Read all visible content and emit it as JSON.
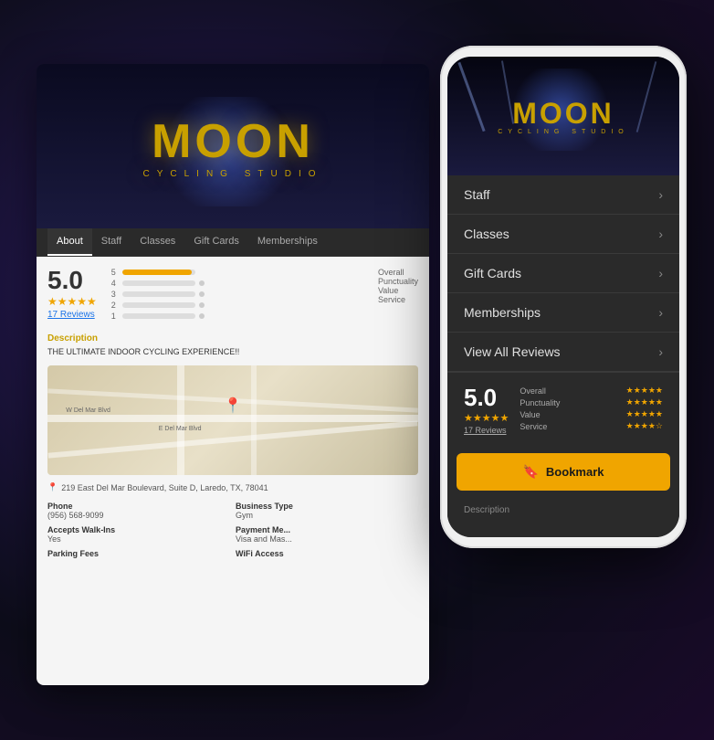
{
  "background": {
    "color": "#1a1a2e"
  },
  "desktop": {
    "logo_text": "MOON",
    "logo_subtitle": "CYCLING  STUDIO",
    "nav_items": [
      {
        "label": "About",
        "active": true
      },
      {
        "label": "Staff",
        "active": false
      },
      {
        "label": "Classes",
        "active": false
      },
      {
        "label": "Gift Cards",
        "active": false
      },
      {
        "label": "Memberships",
        "active": false
      }
    ],
    "rating": {
      "score": "5.0",
      "stars": "★★★★★",
      "reviews_label": "17 Reviews",
      "bars": [
        {
          "num": "5",
          "width": "95%"
        },
        {
          "num": "4",
          "width": "0%"
        },
        {
          "num": "3",
          "width": "0%"
        },
        {
          "num": "2",
          "width": "0%"
        },
        {
          "num": "1",
          "width": "0%"
        }
      ]
    },
    "description_title": "Description",
    "description_text": "THE ULTIMATE INDOOR CYCLING EXPERIENCE!!",
    "address": "219 East Del Mar Boulevard, Suite D, Laredo, TX, 78041",
    "info": [
      {
        "label": "Phone",
        "value": "(956) 568-9099"
      },
      {
        "label": "Business Type",
        "value": "Gym"
      },
      {
        "label": "Accepts Walk-Ins",
        "value": "Yes"
      },
      {
        "label": "Payment Me...",
        "value": "Visa and Mas..."
      },
      {
        "label": "Parking Fees",
        "value": ""
      },
      {
        "label": "WiFi Access",
        "value": ""
      }
    ]
  },
  "phone": {
    "logo_text": "MOON",
    "logo_subtitle": "CYCLING  STUDIO",
    "menu_items": [
      {
        "label": "Staff"
      },
      {
        "label": "Classes"
      },
      {
        "label": "Gift Cards"
      },
      {
        "label": "Memberships"
      },
      {
        "label": "View All Reviews"
      }
    ],
    "rating": {
      "score": "5.0",
      "stars": "★★★★★",
      "reviews_label": "17 Reviews",
      "details": [
        {
          "label": "Overall",
          "stars": "★★★★★"
        },
        {
          "label": "Punctuality",
          "stars": "★★★★★"
        },
        {
          "label": "Value",
          "stars": "★★★★★"
        },
        {
          "label": "Service",
          "stars": "★★★★☆"
        }
      ]
    },
    "bookmark_label": "Bookmark",
    "description_label": "Description"
  }
}
